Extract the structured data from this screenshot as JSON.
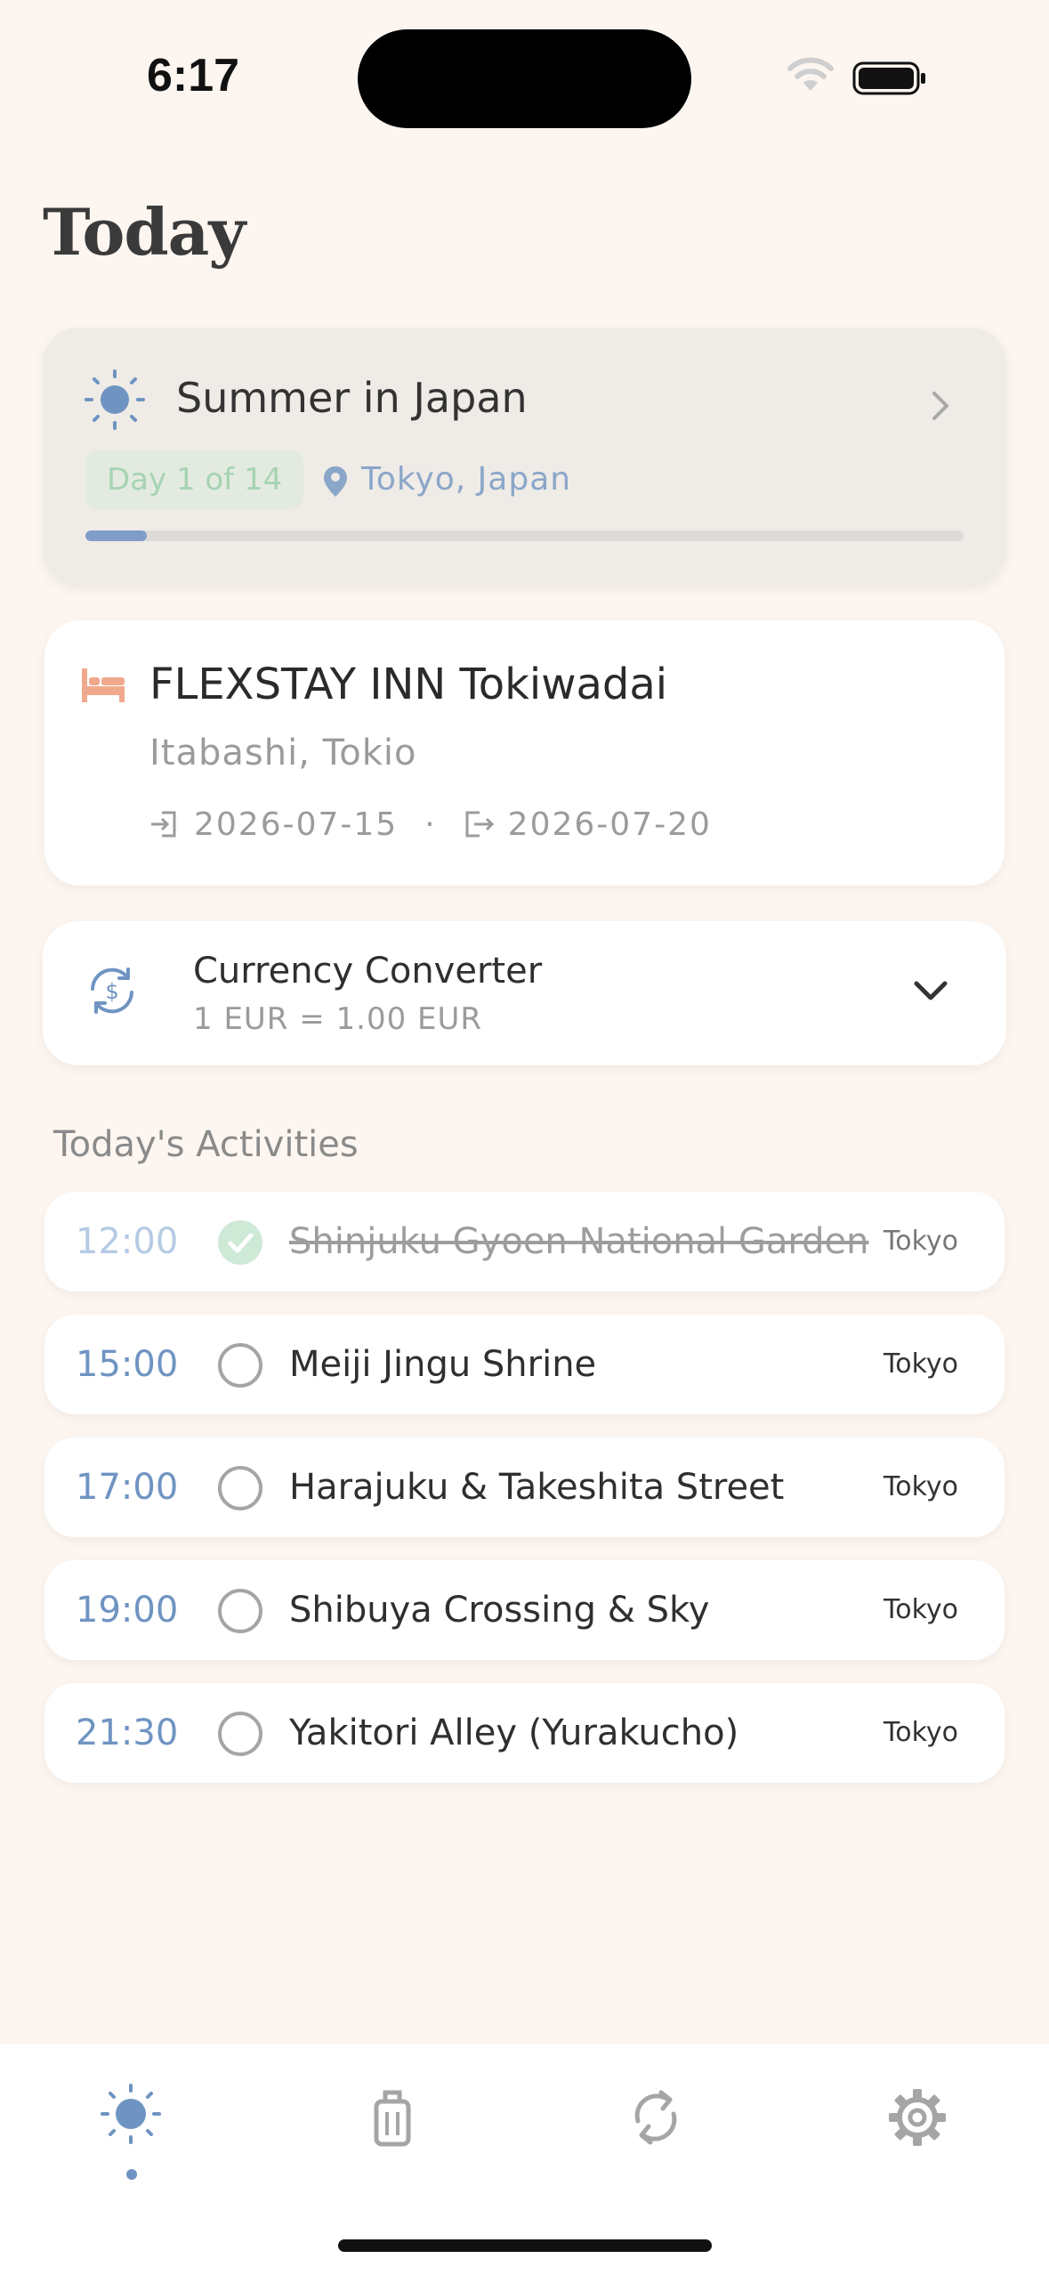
{
  "status_bar": {
    "time": "6:17"
  },
  "page": {
    "title": "Today"
  },
  "trip": {
    "name": "Summer in Japan",
    "day_badge": "Day 1 of 14",
    "location": "Tokyo, Japan",
    "progress": 0.07,
    "accent_color": "#7f9dc8"
  },
  "hotel": {
    "name": "FLEXSTAY INN Tokiwadai",
    "address": "Itabashi, Tokio",
    "check_in": "2026-07-15",
    "separator": "·",
    "check_out": "2026-07-20"
  },
  "currency": {
    "title": "Currency Converter",
    "rate": "1 EUR = 1.00 EUR"
  },
  "activities": {
    "section_label": "Today's Activities",
    "items": [
      {
        "time": "12:00",
        "name": "Shinjuku Gyoen National Garden",
        "city": "Tokyo",
        "done": true
      },
      {
        "time": "15:00",
        "name": "Meiji Jingu Shrine",
        "city": "Tokyo",
        "done": false
      },
      {
        "time": "17:00",
        "name": "Harajuku & Takeshita Street",
        "city": "Tokyo",
        "done": false
      },
      {
        "time": "19:00",
        "name": "Shibuya Crossing & Sky",
        "city": "Tokyo",
        "done": false
      },
      {
        "time": "21:30",
        "name": "Yakitori Alley (Yurakucho)",
        "city": "Tokyo",
        "done": false
      }
    ]
  },
  "tabbar": {
    "tabs": [
      {
        "icon": "sun-icon",
        "active": true
      },
      {
        "icon": "luggage-icon",
        "active": false
      },
      {
        "icon": "sync-icon",
        "active": false
      },
      {
        "icon": "gear-icon",
        "active": false
      }
    ]
  }
}
